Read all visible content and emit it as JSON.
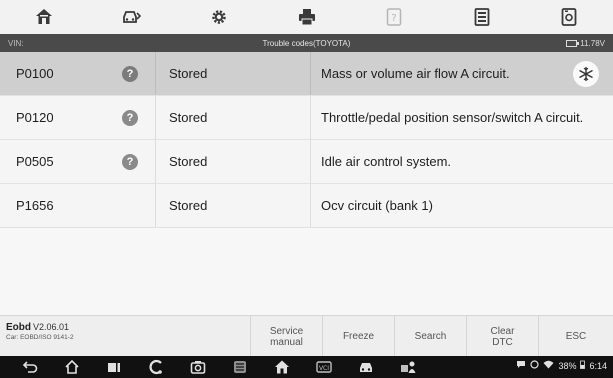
{
  "toolbar": {
    "buttons": [
      {
        "icon": "home-icon"
      },
      {
        "icon": "vehicle-swap-icon"
      },
      {
        "icon": "settings-icon"
      },
      {
        "icon": "print-icon"
      },
      {
        "icon": "help-icon"
      },
      {
        "icon": "data-log-icon"
      },
      {
        "icon": "screenshot-icon"
      }
    ]
  },
  "titlebar": {
    "vin_label": "VIN:",
    "title": "Trouble codes(TOYOTA)",
    "voltage": "11.78V"
  },
  "dtc_rows": [
    {
      "code": "P0100",
      "has_help": true,
      "status": "Stored",
      "description": "Mass or volume air flow A circuit.",
      "selected": true
    },
    {
      "code": "P0120",
      "has_help": true,
      "status": "Stored",
      "description": "Throttle/pedal position sensor/switch A circuit.",
      "selected": false
    },
    {
      "code": "P0505",
      "has_help": true,
      "status": "Stored",
      "description": "Idle air control system.",
      "selected": false
    },
    {
      "code": "P1656",
      "has_help": false,
      "status": "Stored",
      "description": "Ocv circuit (bank 1)",
      "selected": false
    }
  ],
  "help_glyph": "?",
  "bottombar": {
    "app_name": "Eobd",
    "version": "V2.06.01",
    "car_info": "Car: EOBD/ISO 9141-2",
    "buttons": {
      "service_manual_l1": "Service",
      "service_manual_l2": "manual",
      "freeze": "Freeze",
      "search": "Search",
      "clear_dtc_l1": "Clear",
      "clear_dtc_l2": "DTC",
      "esc": "ESC"
    }
  },
  "statusbar": {
    "battery": "38%",
    "time": "6:14"
  },
  "colors": {
    "toolbar_bg": "#f2f2f2",
    "titlebar_bg": "#4a4a4a",
    "row_bg": "#f5f5f5",
    "row_selected_bg": "#cfcfcf",
    "navbar_bg": "#111111"
  }
}
